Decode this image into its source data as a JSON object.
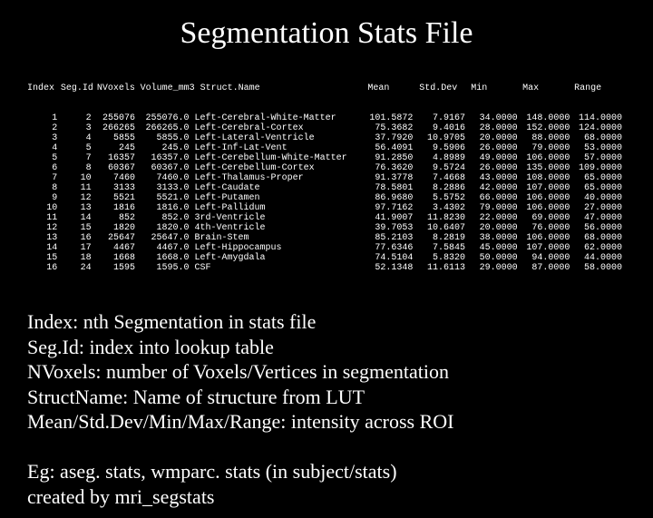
{
  "title": "Segmentation Stats File",
  "headers": {
    "index": "Index",
    "seg": "Seg.Id",
    "nvox": "NVoxels",
    "vol": "Volume_mm3",
    "name": "Struct.Name",
    "mean": "Mean",
    "std": "Std.Dev",
    "min": "Min",
    "max": "Max",
    "range": "Range"
  },
  "rows": [
    {
      "index": "1",
      "seg": "2",
      "nvox": "255076",
      "vol": "255076.0",
      "name": "Left-Cerebral-White-Matter",
      "mean": "101.5872",
      "std": "7.9167",
      "min": "34.0000",
      "max": "148.0000",
      "range": "114.0000"
    },
    {
      "index": "2",
      "seg": "3",
      "nvox": "266265",
      "vol": "266265.0",
      "name": "Left-Cerebral-Cortex",
      "mean": "75.3682",
      "std": "9.4016",
      "min": "28.0000",
      "max": "152.0000",
      "range": "124.0000"
    },
    {
      "index": "3",
      "seg": "4",
      "nvox": "5855",
      "vol": "5855.0",
      "name": "Left-Lateral-Ventricle",
      "mean": "37.7920",
      "std": "10.9705",
      "min": "20.0000",
      "max": "88.0000",
      "range": "68.0000"
    },
    {
      "index": "4",
      "seg": "5",
      "nvox": "245",
      "vol": "245.0",
      "name": "Left-Inf-Lat-Vent",
      "mean": "56.4091",
      "std": "9.5906",
      "min": "26.0000",
      "max": "79.0000",
      "range": "53.0000"
    },
    {
      "index": "5",
      "seg": "7",
      "nvox": "16357",
      "vol": "16357.0",
      "name": "Left-Cerebellum-White-Matter",
      "mean": "91.2850",
      "std": "4.8989",
      "min": "49.0000",
      "max": "106.0000",
      "range": "57.0000"
    },
    {
      "index": "6",
      "seg": "8",
      "nvox": "60367",
      "vol": "60367.0",
      "name": "Left-Cerebellum-Cortex",
      "mean": "76.3620",
      "std": "9.5724",
      "min": "26.0000",
      "max": "135.0000",
      "range": "109.0000"
    },
    {
      "index": "7",
      "seg": "10",
      "nvox": "7460",
      "vol": "7460.0",
      "name": "Left-Thalamus-Proper",
      "mean": "91.3778",
      "std": "7.4668",
      "min": "43.0000",
      "max": "108.0000",
      "range": "65.0000"
    },
    {
      "index": "8",
      "seg": "11",
      "nvox": "3133",
      "vol": "3133.0",
      "name": "Left-Caudate",
      "mean": "78.5801",
      "std": "8.2886",
      "min": "42.0000",
      "max": "107.0000",
      "range": "65.0000"
    },
    {
      "index": "9",
      "seg": "12",
      "nvox": "5521",
      "vol": "5521.0",
      "name": "Left-Putamen",
      "mean": "86.9680",
      "std": "5.5752",
      "min": "66.0000",
      "max": "106.0000",
      "range": "40.0000"
    },
    {
      "index": "10",
      "seg": "13",
      "nvox": "1816",
      "vol": "1816.0",
      "name": "Left-Pallidum",
      "mean": "97.7162",
      "std": "3.4302",
      "min": "79.0000",
      "max": "106.0000",
      "range": "27.0000"
    },
    {
      "index": "11",
      "seg": "14",
      "nvox": "852",
      "vol": "852.0",
      "name": "3rd-Ventricle",
      "mean": "41.9007",
      "std": "11.8230",
      "min": "22.0000",
      "max": "69.0000",
      "range": "47.0000"
    },
    {
      "index": "12",
      "seg": "15",
      "nvox": "1820",
      "vol": "1820.0",
      "name": "4th-Ventricle",
      "mean": "39.7053",
      "std": "10.6407",
      "min": "20.0000",
      "max": "76.0000",
      "range": "56.0000"
    },
    {
      "index": "13",
      "seg": "16",
      "nvox": "25647",
      "vol": "25647.0",
      "name": "Brain-Stem",
      "mean": "85.2103",
      "std": "8.2819",
      "min": "38.0000",
      "max": "106.0000",
      "range": "68.0000"
    },
    {
      "index": "14",
      "seg": "17",
      "nvox": "4467",
      "vol": "4467.0",
      "name": "Left-Hippocampus",
      "mean": "77.6346",
      "std": "7.5845",
      "min": "45.0000",
      "max": "107.0000",
      "range": "62.0000"
    },
    {
      "index": "15",
      "seg": "18",
      "nvox": "1668",
      "vol": "1668.0",
      "name": "Left-Amygdala",
      "mean": "74.5104",
      "std": "5.8320",
      "min": "50.0000",
      "max": "94.0000",
      "range": "44.0000"
    },
    {
      "index": "16",
      "seg": "24",
      "nvox": "1595",
      "vol": "1595.0",
      "name": "CSF",
      "mean": "52.1348",
      "std": "11.6113",
      "min": "29.0000",
      "max": "87.0000",
      "range": "58.0000"
    }
  ],
  "legend": [
    "Index: nth Segmentation in stats file",
    "Seg.Id: index into lookup table",
    "NVoxels: number of Voxels/Vertices in segmentation",
    "StructName: Name of structure from LUT",
    "Mean/Std.Dev/Min/Max/Range: intensity across ROI",
    "",
    "Eg: aseg. stats, wmparc. stats (in subject/stats)",
    "created by mri_segstats"
  ]
}
